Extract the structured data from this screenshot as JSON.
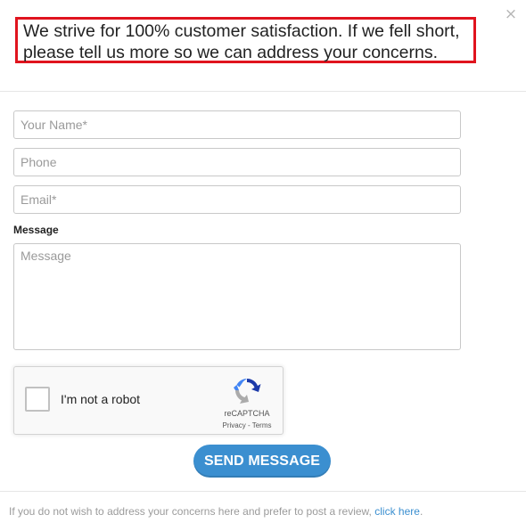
{
  "header": {
    "line1": "We strive for 100% customer satisfaction. If we fell short,",
    "line2": "please tell us more so we can address your concerns."
  },
  "close": {
    "symbol": "×",
    "icon": "close-icon"
  },
  "form": {
    "name_placeholder": "Your Name*",
    "phone_placeholder": "Phone",
    "email_placeholder": "Email*",
    "message_label": "Message",
    "message_placeholder": "Message",
    "send_label": "SEND MESSAGE"
  },
  "recaptcha": {
    "checkbox_label": "I'm not a robot",
    "brand": "reCAPTCHA",
    "privacy": "Privacy",
    "separator": " - ",
    "terms": "Terms",
    "icon": "recaptcha-logo-icon"
  },
  "footer": {
    "text": "If you do not wish to address your concerns here and prefer to post a review,",
    "link_label": "click here",
    "period": "."
  },
  "colors": {
    "accent": "#3b8fd0",
    "highlight_border": "#e0141e",
    "muted_text": "#9b9b9b"
  }
}
